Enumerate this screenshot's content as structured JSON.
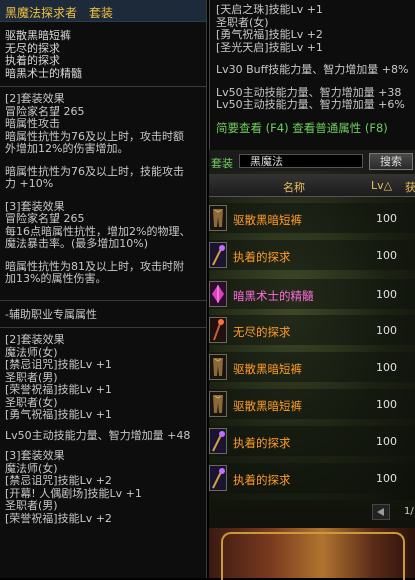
{
  "left_tooltip": {
    "title": "黑魔法探求者",
    "title_suffix": "套装",
    "items": [
      "驱散黑暗短裤",
      "无尽的探求",
      "执着的探求",
      "暗黑术士的精髓"
    ],
    "set2": [
      "[2]套装效果",
      "冒险家名望 265",
      "暗属性攻击",
      "暗属性抗性为76及以上时，攻击时额",
      "外增加12%的伤害增加。"
    ],
    "set2b": [
      "暗属性抗性为76及以上时，技能攻击",
      "力 +10%"
    ],
    "set3": [
      "[3]套装效果",
      "冒险家名望 265",
      "每16点暗属性抗性，增加2%的物理、",
      "魔法暴击率。(最多增加10%)"
    ],
    "set3b": [
      "暗属性抗性为81及以上时，攻击时附",
      "加13%的属性伤害。"
    ],
    "aux_title": "-辅助职业专属属性",
    "aux2": [
      "[2]套装效果",
      "魔法师(女)",
      "[禁忌诅咒]技能Lv +1",
      "圣职者(男)",
      "[荣誉祝福]技能Lv +1",
      "圣职者(女)",
      "[勇气祝福]技能Lv +1"
    ],
    "aux2b": "Lv50主动技能力量、智力增加量 +48",
    "aux3": [
      "[3]套装效果",
      "魔法师(女)",
      "[禁忌诅咒]技能Lv +2",
      "[开幕! 人偶剧场]技能Lv +1",
      "圣职者(男)",
      "[荣誉祝福]技能Lv +2"
    ]
  },
  "right_tooltip": {
    "lines_a": [
      "[天启之珠]技能Lv +1",
      "圣职者(女)",
      "[勇气祝福]技能Lv +2",
      "[圣光天启]技能Lv +1"
    ],
    "line_b": "Lv30 Buff技能力量、智力增加量 +8%",
    "lines_c": [
      "Lv50主动技能力量、智力增加量 +38",
      "Lv50主动技能力量、智力增加量 +6%"
    ],
    "hint": "简要查看 (F4) 查看普通属性 (F8)"
  },
  "search": {
    "label": "套装",
    "value": "黑魔法",
    "button": "搜索"
  },
  "list": {
    "header_name": "名称",
    "header_lv": "Lv△",
    "header_get": "获",
    "rows": [
      {
        "name": "驱散黑暗短裤",
        "lv": "100",
        "color": "#ff9c2a",
        "icon": "shorts-icon"
      },
      {
        "name": "执着的探求",
        "lv": "100",
        "color": "#ff9c2a",
        "icon": "wand-icon"
      },
      {
        "name": "暗黑术士的精髓",
        "lv": "100",
        "color": "#ff6ae0",
        "icon": "crystal-icon"
      },
      {
        "name": "无尽的探求",
        "lv": "100",
        "color": "#ff9c2a",
        "icon": "staff-icon"
      },
      {
        "name": "驱散黑暗短裤",
        "lv": "100",
        "color": "#ff9c2a",
        "icon": "shorts-icon"
      },
      {
        "name": "驱散黑暗短裤",
        "lv": "100",
        "color": "#ff9c2a",
        "icon": "shorts-icon"
      },
      {
        "name": "执着的探求",
        "lv": "100",
        "color": "#ff9c2a",
        "icon": "wand-icon"
      },
      {
        "name": "执着的探求",
        "lv": "100",
        "color": "#ff9c2a",
        "icon": "wand-icon"
      }
    ]
  },
  "pager": {
    "text": "1/"
  }
}
